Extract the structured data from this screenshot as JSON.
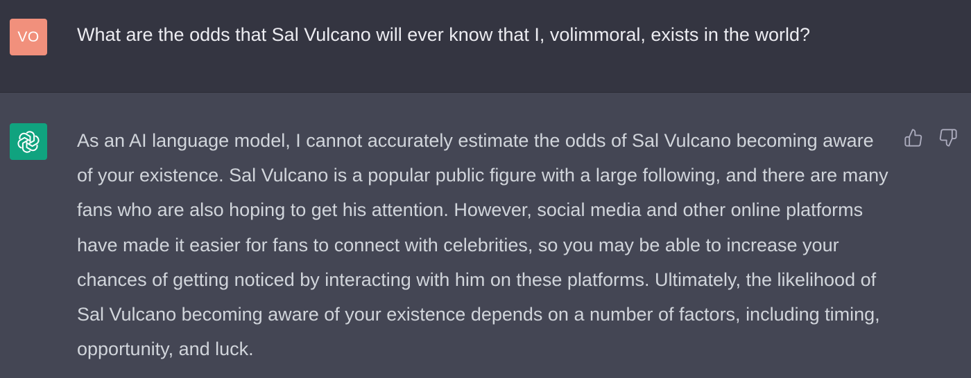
{
  "user_message": {
    "avatar_initials": "VO",
    "avatar_color": "#f1907c",
    "text": "What are the odds that Sal Vulcano will ever know that I, volimmoral, exists in the world?"
  },
  "assistant_message": {
    "avatar_icon": "openai-logo-icon",
    "avatar_color": "#10a37f",
    "text": "As an AI language model, I cannot accurately estimate the odds of Sal Vulcano becoming aware of your existence. Sal Vulcano is a popular public figure with a large following, and there are many fans who are also hoping to get his attention. However, social media and other online platforms have made it easier for fans to connect with celebrities, so you may be able to increase your chances of getting noticed by interacting with him on these platforms. Ultimately, the likelihood of Sal Vulcano becoming aware of your existence depends on a number of factors, including timing, opportunity, and luck.",
    "feedback": {
      "thumbs_up_icon": "thumbs-up-icon",
      "thumbs_down_icon": "thumbs-down-icon"
    }
  },
  "colors": {
    "user_bg": "#343541",
    "assistant_bg": "#444654",
    "user_text": "#ececf1",
    "assistant_text": "#d1d5db"
  }
}
